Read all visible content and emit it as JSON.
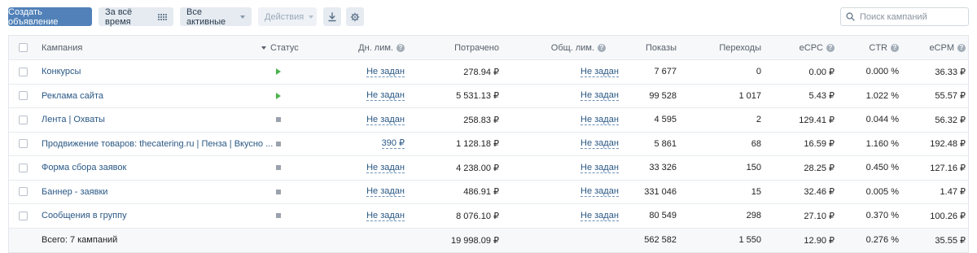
{
  "toolbar": {
    "create_label": "Создать объявление",
    "period_label": "За всё время",
    "filter_label": "Все активные",
    "actions_label": "Действия",
    "search_placeholder": "Поиск кампаний"
  },
  "table": {
    "headers": {
      "name": "Кампания",
      "status": "Статус",
      "day_limit": "Дн. лим.",
      "spent": "Потрачено",
      "total_limit": "Общ. лим.",
      "shows": "Показы",
      "clicks": "Переходы",
      "ecpc": "eCPC",
      "ctr": "CTR",
      "ecpm": "eCPM"
    },
    "help_glyph": "?",
    "rows": [
      {
        "name": "Конкурсы",
        "status": "active",
        "day_limit": "Не задан",
        "spent": "278.94 ₽",
        "total_limit": "Не задан",
        "shows": "7 677",
        "clicks": "0",
        "ecpc": "0.00 ₽",
        "ctr": "0.000 %",
        "ecpm": "36.33 ₽"
      },
      {
        "name": "Реклама сайта",
        "status": "active",
        "day_limit": "Не задан",
        "spent": "5 531.13 ₽",
        "total_limit": "Не задан",
        "shows": "99 528",
        "clicks": "1 017",
        "ecpc": "5.43 ₽",
        "ctr": "1.022 %",
        "ecpm": "55.57 ₽"
      },
      {
        "name": "Лента | Охваты",
        "status": "stopped",
        "day_limit": "Не задан",
        "spent": "258.83 ₽",
        "total_limit": "Не задан",
        "shows": "4 595",
        "clicks": "2",
        "ecpc": "129.41 ₽",
        "ctr": "0.044 %",
        "ecpm": "56.32 ₽"
      },
      {
        "name": "Продвижение товаров: thecatering.ru | Пенза | Вкусно ...",
        "status": "stopped",
        "day_limit": "390 ₽",
        "spent": "1 128.18 ₽",
        "total_limit": "Не задан",
        "shows": "5 861",
        "clicks": "68",
        "ecpc": "16.59 ₽",
        "ctr": "1.160 %",
        "ecpm": "192.48 ₽"
      },
      {
        "name": "Форма сбора заявок",
        "status": "stopped",
        "day_limit": "Не задан",
        "spent": "4 238.00 ₽",
        "total_limit": "Не задан",
        "shows": "33 326",
        "clicks": "150",
        "ecpc": "28.25 ₽",
        "ctr": "0.450 %",
        "ecpm": "127.16 ₽"
      },
      {
        "name": "Баннер - заявки",
        "status": "stopped",
        "day_limit": "Не задан",
        "spent": "486.91 ₽",
        "total_limit": "Не задан",
        "shows": "331 046",
        "clicks": "15",
        "ecpc": "32.46 ₽",
        "ctr": "0.005 %",
        "ecpm": "1.47 ₽"
      },
      {
        "name": "Сообщения в группу",
        "status": "stopped",
        "day_limit": "Не задан",
        "spent": "8 076.10 ₽",
        "total_limit": "Не задан",
        "shows": "80 549",
        "clicks": "298",
        "ecpc": "27.10 ₽",
        "ctr": "0.370 %",
        "ecpm": "100.26 ₽"
      }
    ],
    "total": {
      "label": "Всего: 7 кампаний",
      "spent": "19 998.09 ₽",
      "shows": "562 582",
      "clicks": "1 550",
      "ecpc": "12.90 ₽",
      "ctr": "0.276 %",
      "ecpm": "35.55 ₽"
    }
  },
  "colors": {
    "accent": "#5181b8",
    "link": "#2a5885",
    "status_active": "#4bb34b",
    "status_stopped": "#99a2ad"
  }
}
